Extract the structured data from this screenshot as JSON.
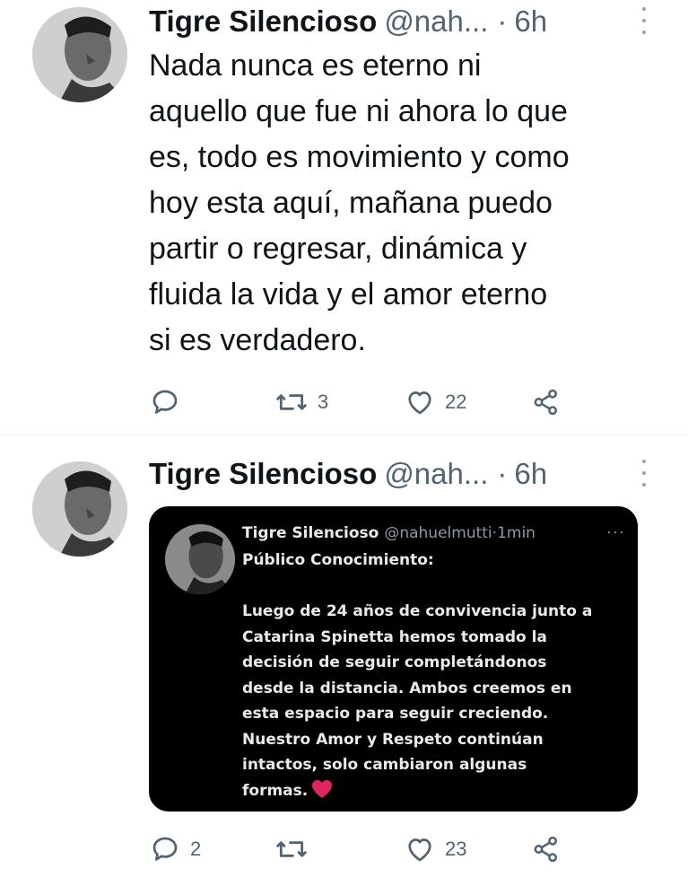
{
  "colors": {
    "text": "#0f1419",
    "muted": "#536471",
    "embed_bg": "#000000",
    "emoji_heart": "#e0245e"
  },
  "tweets": [
    {
      "author_name": "Tigre Silencioso",
      "handle": "@nah...",
      "separator": "·",
      "time": "6h",
      "text": "Nada nunca es eterno ni\naquello que fue ni ahora lo que\nes, todo es movimiento y como\nhoy esta aquí, mañana puedo\npartir o regresar, dinámica y\nfluida la vida y el amor eterno\nsi es verdadero.",
      "actions": {
        "reply_count": "",
        "retweet_count": "3",
        "like_count": "22"
      },
      "icons": [
        "reply-icon",
        "retweet-icon",
        "like-icon",
        "share-icon"
      ]
    },
    {
      "author_name": "Tigre Silencioso",
      "handle": "@nah...",
      "separator": "·",
      "time": "6h",
      "embedded": {
        "author_name": "Tigre Silencioso",
        "handle": "@nahuelmutti",
        "separator": "·",
        "time": "1min",
        "more": "···",
        "text": "Público Conocimiento:\n\nLuego de 24 años de convivencia junto a\nCatarina Spinetta hemos tomado la\ndecisión de seguir completándonos\ndesde la distancia. Ambos creemos en\nesta espacio para seguir creciendo.\nNuestro Amor y Respeto continúan\nintactos, solo cambiaron algunas\nformas.",
        "emoji": "heart-emoji"
      },
      "actions": {
        "reply_count": "2",
        "retweet_count": "",
        "like_count": "23"
      },
      "icons": [
        "reply-icon",
        "retweet-icon",
        "like-icon",
        "share-icon"
      ]
    }
  ]
}
